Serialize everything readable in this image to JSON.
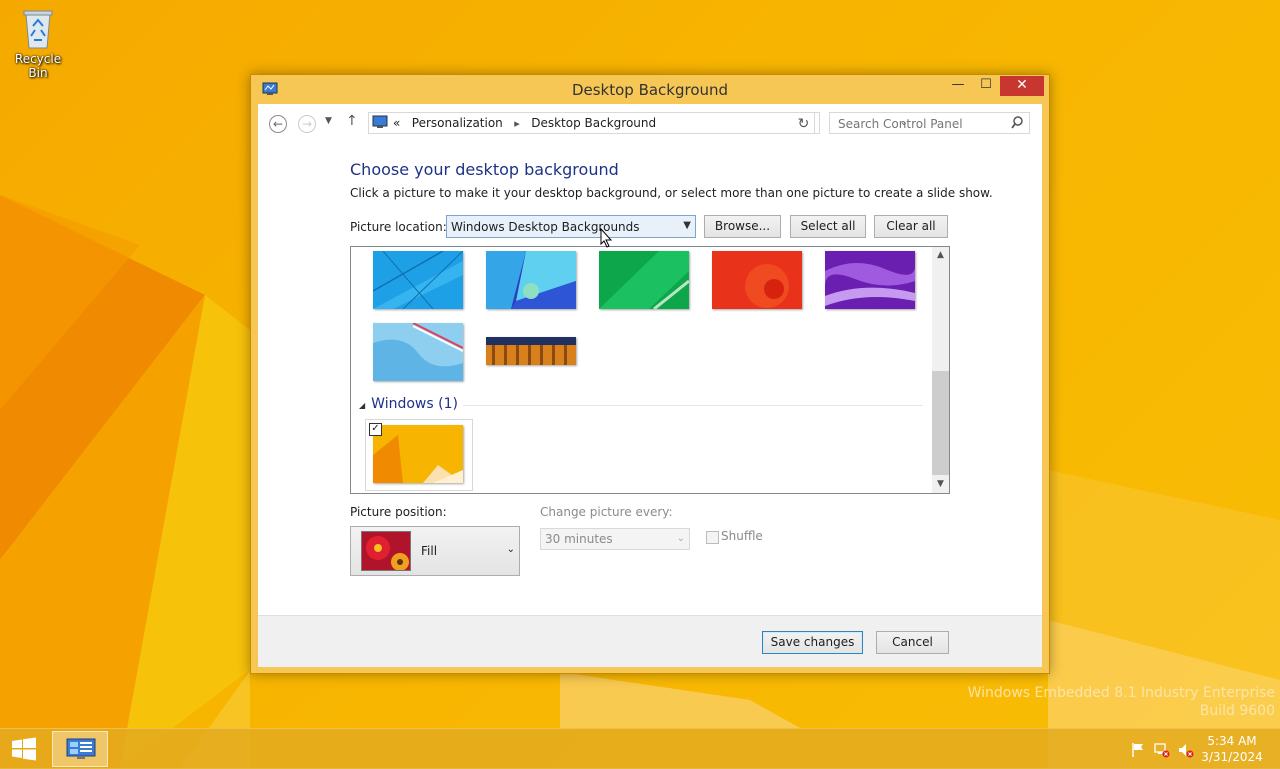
{
  "desktop": {
    "recycle_bin_label": "Recycle Bin",
    "edition_line1": "Windows Embedded 8.1 Industry Enterprise",
    "edition_line2": "Build 9600"
  },
  "window": {
    "title": "Desktop Background",
    "minimize": "—",
    "maximize": "☐",
    "close": "✕"
  },
  "address_bar": {
    "back": "←",
    "forward": "→",
    "history": "▼",
    "up": "↑",
    "prefix": "«",
    "crumbs": [
      "Personalization",
      "Desktop Background"
    ],
    "separator": "▸",
    "dropdown": "⌄",
    "refresh": "↻",
    "search_placeholder": "Search Control Panel"
  },
  "main": {
    "heading": "Choose your desktop background",
    "subtitle": "Click a picture to make it your desktop background, or select more than one picture to create a slide show.",
    "location_label": "Picture location:",
    "location_value": "Windows Desktop Backgrounds",
    "browse_label": "Browse...",
    "select_all_label": "Select all",
    "clear_all_label": "Clear all",
    "group_name": "Windows (1)",
    "group_checked": "✓",
    "position_label": "Picture position:",
    "position_value": "Fill",
    "change_label": "Change picture every:",
    "interval_value": "30 minutes",
    "shuffle_label": "Shuffle",
    "save_label": "Save changes",
    "cancel_label": "Cancel"
  },
  "taskbar": {
    "time": "5:34 AM",
    "date": "3/31/2024"
  },
  "colors": {
    "wallpaper": "#f7b400",
    "link_blue": "#1e3287",
    "close_red": "#c7372f"
  },
  "icons": [
    "recycle-bin-icon",
    "control-panel-icon",
    "search-icon",
    "windows-logo-icon",
    "flag-icon",
    "network-icon",
    "volume-muted-icon"
  ]
}
